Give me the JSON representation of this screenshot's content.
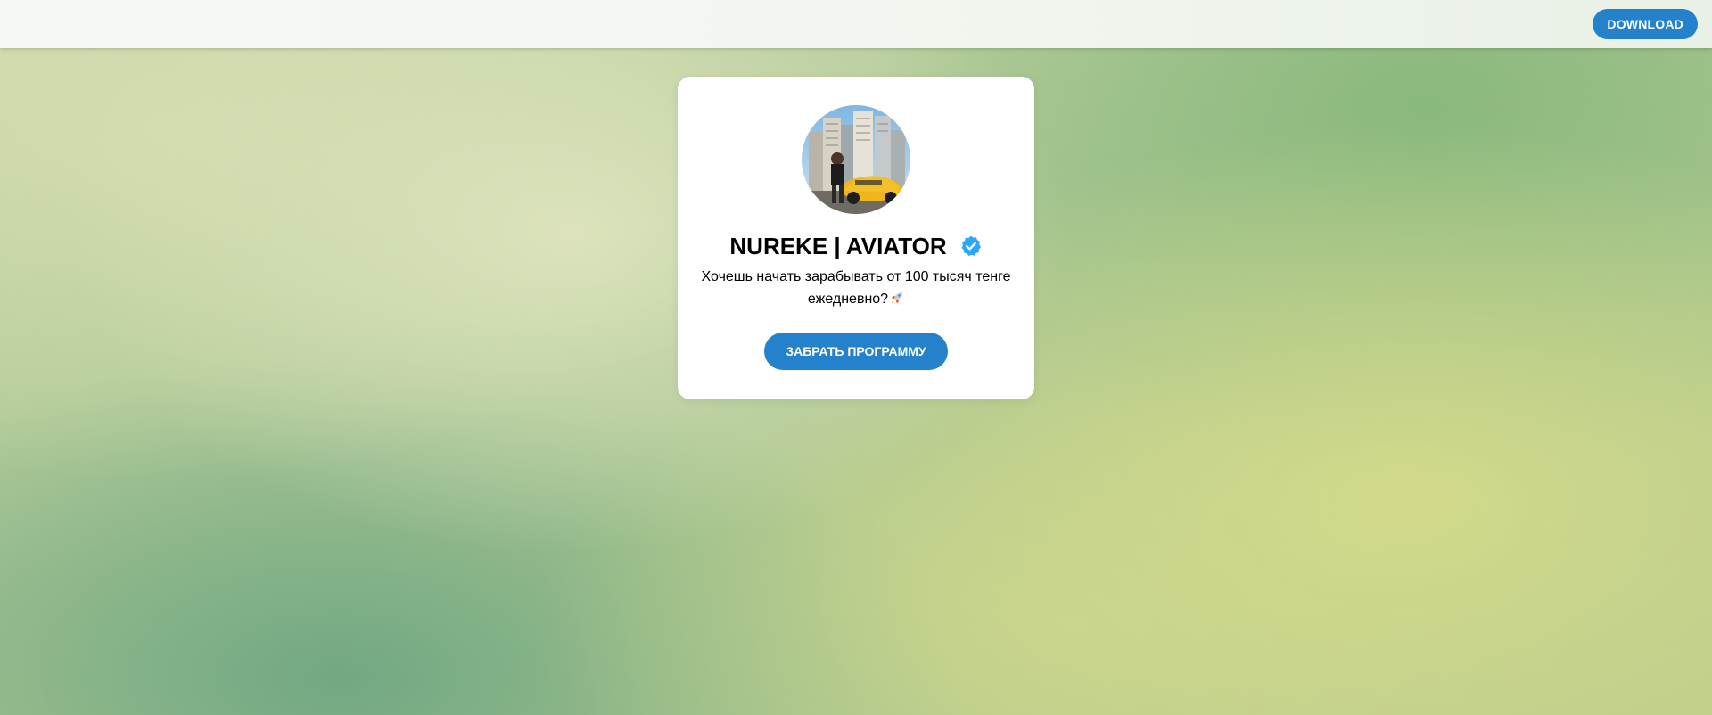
{
  "header": {
    "download_label": "DOWNLOAD"
  },
  "profile": {
    "name": "NUREKE | AVIATOR",
    "verified_icon": "verified-badge-icon",
    "description": "Хочешь начать зарабывать от 100 тысяч тенге ежедневно?",
    "description_emoji": "rocket-icon",
    "cta_label": "ЗАБРАТЬ ПРОГРАММУ"
  },
  "colors": {
    "accent": "#2481cc",
    "verified": "#2ea6ff"
  }
}
